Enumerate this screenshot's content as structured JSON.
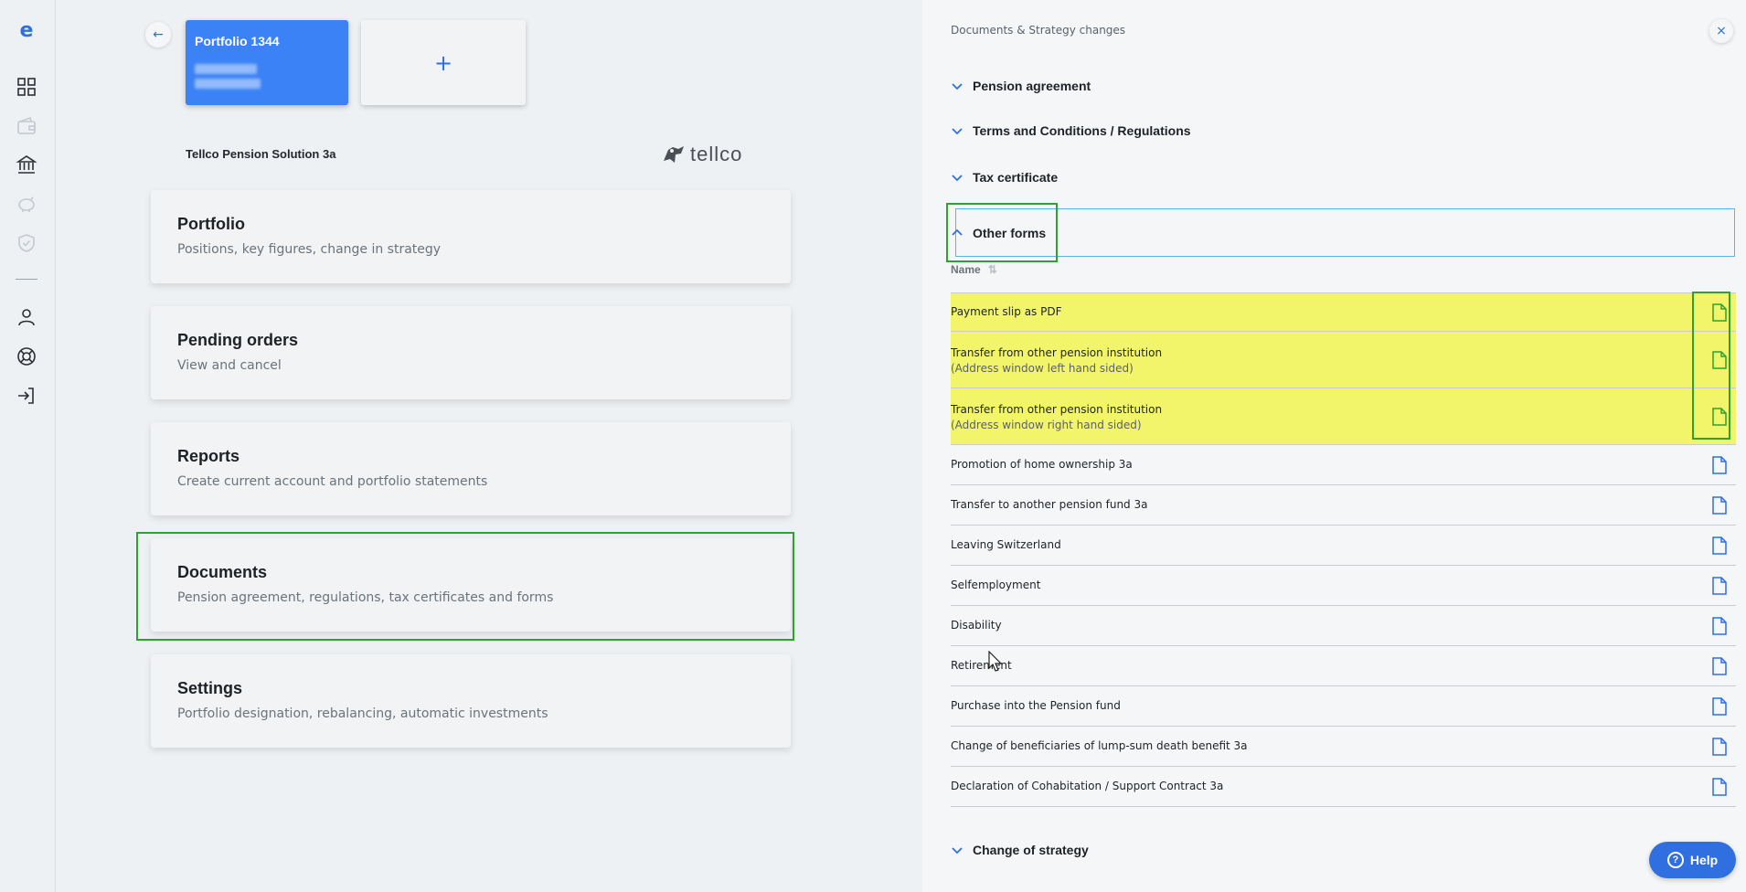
{
  "sidebar": {
    "logo_letter": "e",
    "icons": [
      "dashboard-icon",
      "wallet-icon",
      "bank-icon",
      "piggybank-icon",
      "shield-icon",
      "user-icon",
      "lifebuoy-icon",
      "logout-icon"
    ]
  },
  "main": {
    "portfolio_card_title": "Portfolio 1344",
    "add_card_label": "+",
    "product_name": "Tellco Pension Solution 3a",
    "brand_name": "tellco",
    "menu": [
      {
        "title": "Portfolio",
        "subtitle": "Positions, key figures, change in strategy"
      },
      {
        "title": "Pending orders",
        "subtitle": "View and cancel"
      },
      {
        "title": "Reports",
        "subtitle": "Create current account and portfolio statements"
      },
      {
        "title": "Documents",
        "subtitle": "Pension agreement, regulations, tax certificates and forms"
      },
      {
        "title": "Settings",
        "subtitle": "Portfolio designation, rebalancing, automatic investments"
      }
    ]
  },
  "panel": {
    "title": "Documents & Strategy changes",
    "sections": [
      "Pension agreement",
      "Terms and Conditions / Regulations",
      "Tax certificate",
      "Other forms",
      "Change of strategy"
    ],
    "column_header": "Name",
    "rows": [
      {
        "line1": "Payment slip as PDF",
        "line2": ""
      },
      {
        "line1": "Transfer from other pension institution",
        "line2": "(Address window left hand sided)"
      },
      {
        "line1": "Transfer from other pension institution",
        "line2": "(Address window right hand sided)"
      },
      {
        "line1": "Promotion of home ownership 3a",
        "line2": ""
      },
      {
        "line1": "Transfer to another pension fund 3a",
        "line2": ""
      },
      {
        "line1": "Leaving Switzerland",
        "line2": ""
      },
      {
        "line1": "Selfemployment",
        "line2": ""
      },
      {
        "line1": "Disability",
        "line2": ""
      },
      {
        "line1": "Retirement",
        "line2": ""
      },
      {
        "line1": "Purchase into the Pension fund",
        "line2": ""
      },
      {
        "line1": "Change of beneficiaries of lump-sum death benefit 3a",
        "line2": ""
      },
      {
        "line1": "Declaration of Cohabitation / Support Contract 3a",
        "line2": ""
      }
    ],
    "help_label": "Help"
  },
  "colors": {
    "accent": "#2f6fe0",
    "card_blue": "#3b82f6",
    "highlight_yellow": "#f2f56a",
    "highlight_green": "#2ea12e"
  }
}
